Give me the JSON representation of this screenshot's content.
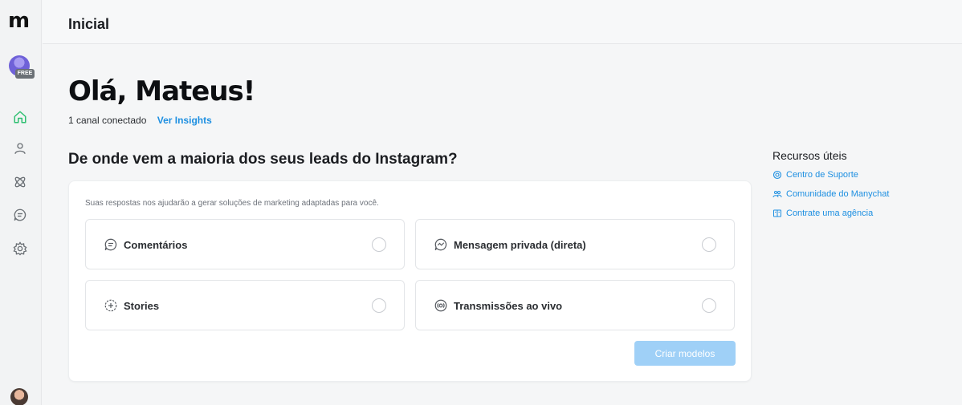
{
  "app": {
    "logo_text": "m",
    "badge": "FREE"
  },
  "header": {
    "title": "Inicial"
  },
  "sidebar": {
    "items": [
      {
        "name": "home",
        "icon": "home-icon",
        "active": true
      },
      {
        "name": "contacts",
        "icon": "user-icon",
        "active": false
      },
      {
        "name": "automation",
        "icon": "automation-icon",
        "active": false
      },
      {
        "name": "chat",
        "icon": "chat-icon",
        "active": false
      },
      {
        "name": "settings",
        "icon": "gear-icon",
        "active": false
      }
    ]
  },
  "main": {
    "greeting": "Olá, Mateus!",
    "channels_text": "1 canal conectado",
    "insights_link": "Ver Insights",
    "question": "De onde vem a maioria dos seus leads do Instagram?",
    "hint": "Suas respostas nos ajudarão a gerar soluções de marketing adaptadas para você.",
    "options": [
      {
        "label": "Comentários",
        "icon": "comment-icon"
      },
      {
        "label": "Mensagem privada (direta)",
        "icon": "direct-message-icon"
      },
      {
        "label": "Stories",
        "icon": "stories-icon"
      },
      {
        "label": "Transmissões ao vivo",
        "icon": "live-icon"
      }
    ],
    "create_button": "Criar modelos"
  },
  "resources": {
    "title": "Recursos úteis",
    "links": [
      {
        "label": "Centro de Suporte",
        "icon": "support-icon"
      },
      {
        "label": "Comunidade do Manychat",
        "icon": "community-icon"
      },
      {
        "label": "Contrate uma agência",
        "icon": "agency-icon"
      }
    ]
  },
  "colors": {
    "accent": "#1d8fe1",
    "active_nav": "#2fbf71",
    "button_disabled": "#9fd0f7"
  }
}
